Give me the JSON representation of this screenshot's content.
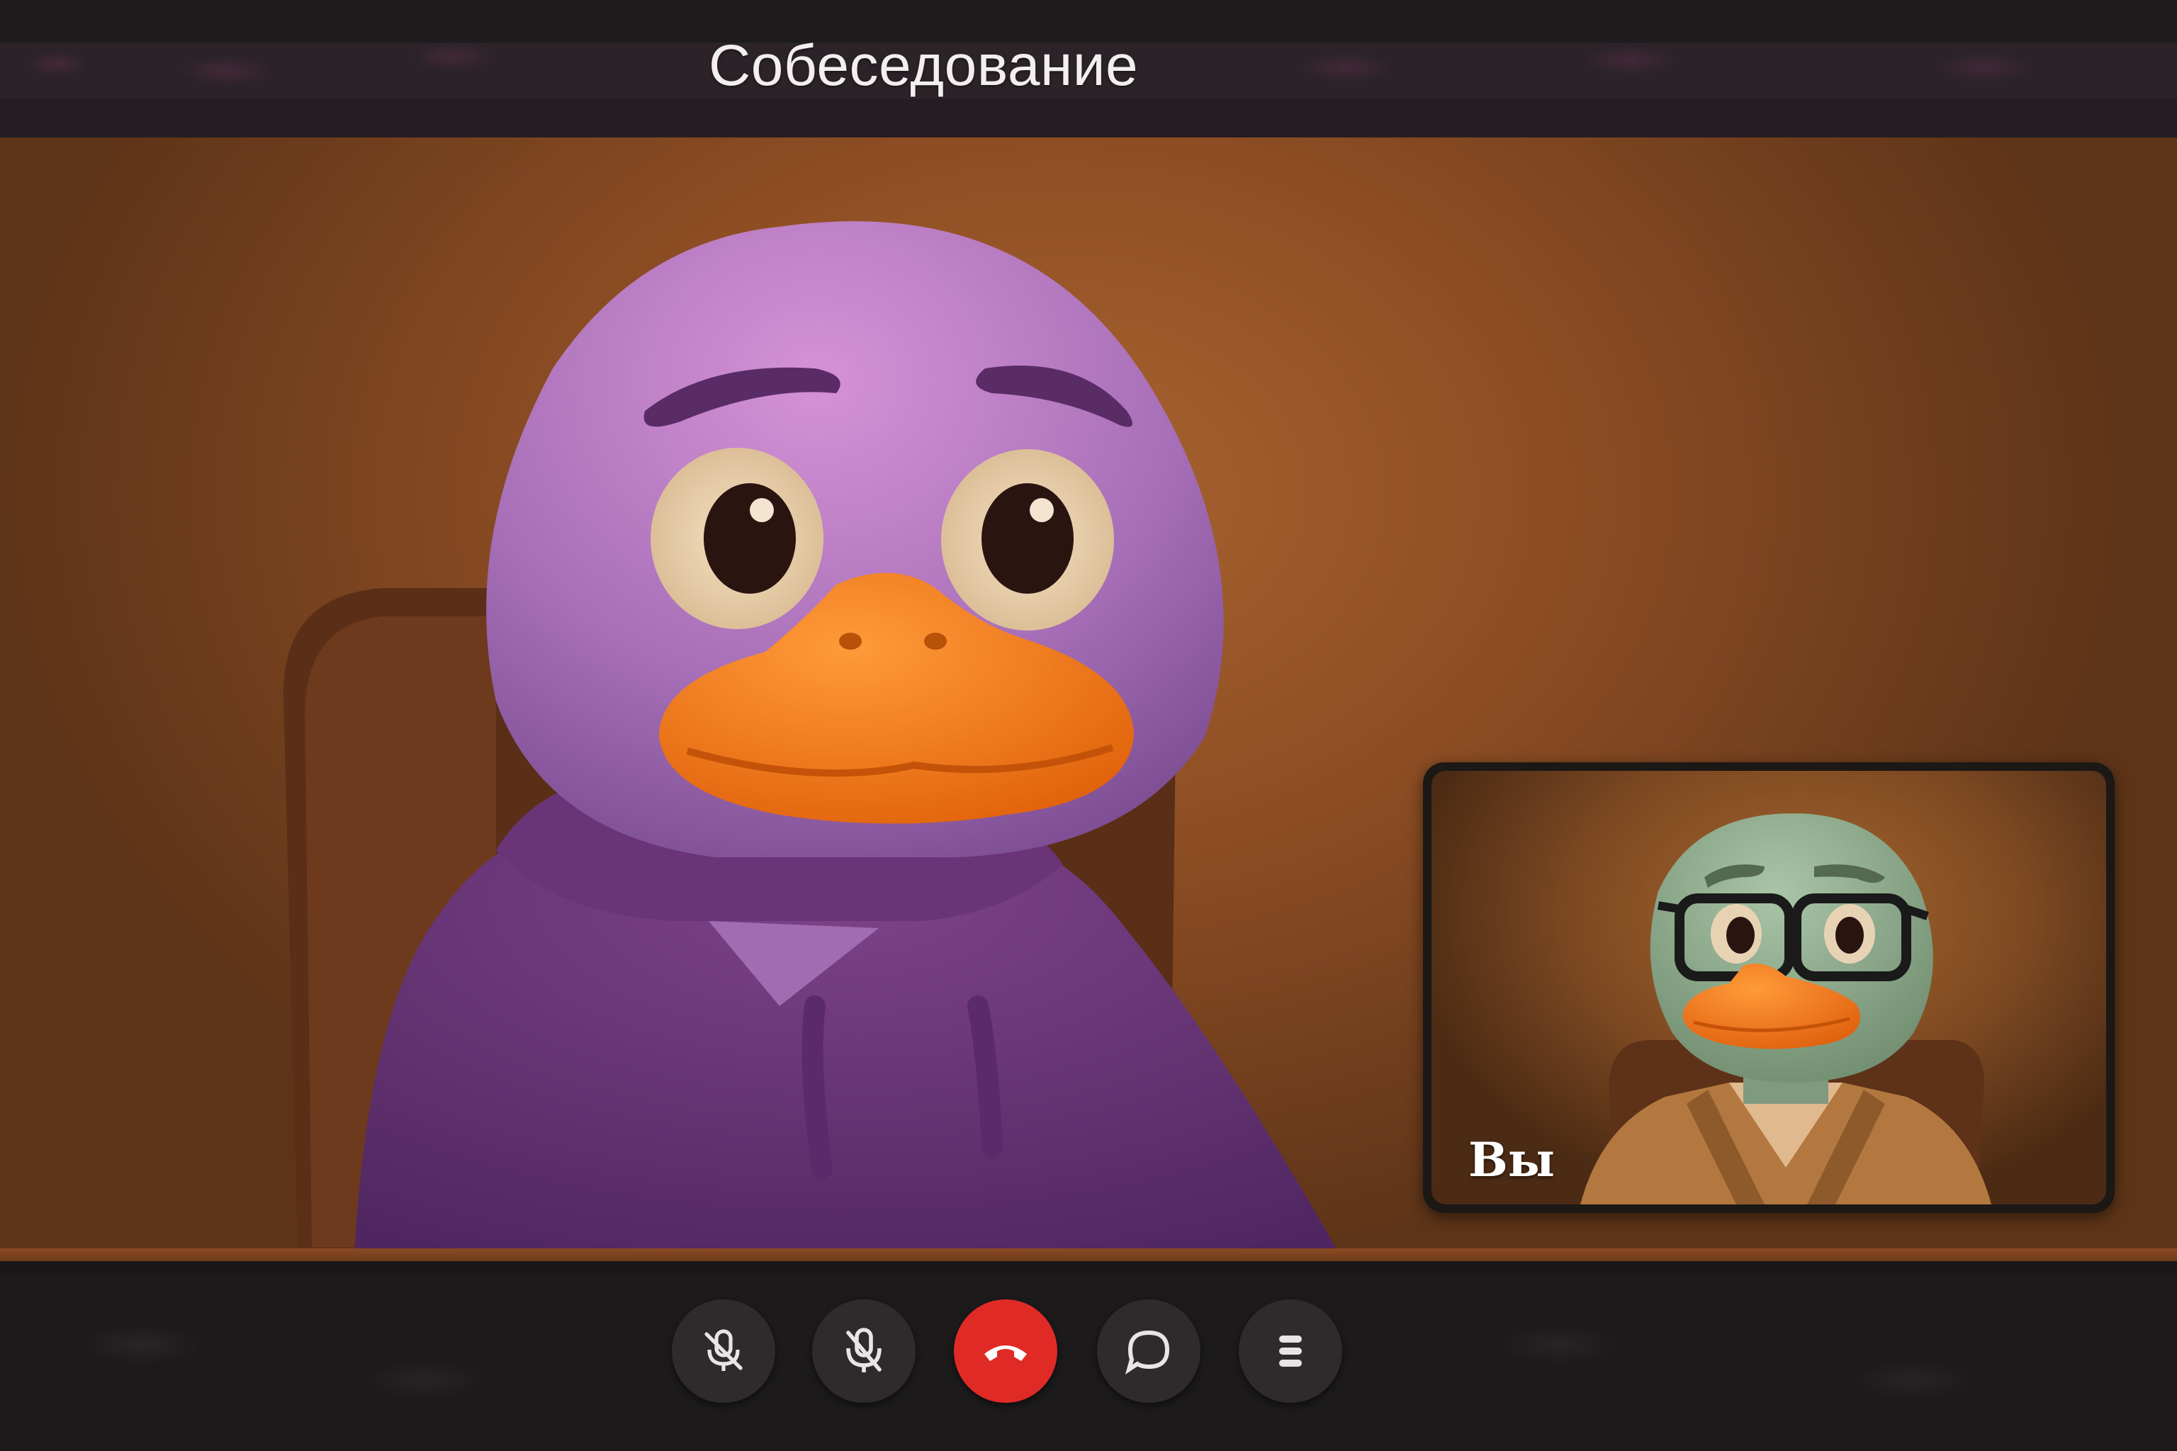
{
  "header": {
    "title": "Собеседование"
  },
  "self_view": {
    "label": "Вы"
  },
  "controls": [
    {
      "name": "mute-microphone-button",
      "icon": "microphone-off-icon"
    },
    {
      "name": "mute-microphone-alt-button",
      "icon": "microphone-off-icon"
    },
    {
      "name": "end-call-button",
      "icon": "phone-hangup-icon"
    },
    {
      "name": "chat-button",
      "icon": "chat-bubble-icon"
    },
    {
      "name": "more-options-button",
      "icon": "menu-icon"
    }
  ],
  "colors": {
    "end_call": "#e02a26",
    "button_bg": "#2f2b2c",
    "background": "#8e4e24"
  }
}
